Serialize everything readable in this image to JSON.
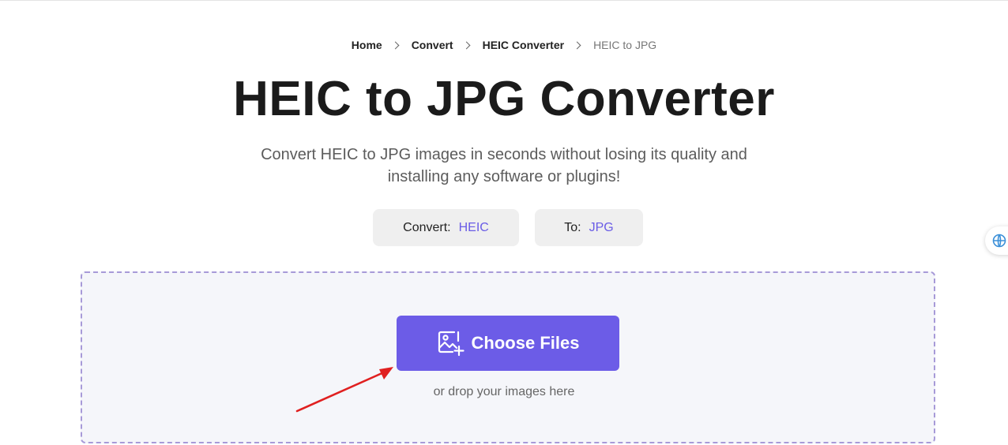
{
  "breadcrumb": {
    "items": [
      "Home",
      "Convert",
      "HEIC Converter",
      "HEIC to JPG"
    ]
  },
  "page": {
    "title": "HEIC to JPG Converter",
    "subtitle": "Convert HEIC to JPG images in seconds without losing its quality and installing any software or plugins!"
  },
  "format_selector": {
    "convert_label": "Convert:",
    "convert_value": "HEIC",
    "to_label": "To:",
    "to_value": "JPG"
  },
  "upload": {
    "button_label": "Choose Files",
    "drop_hint": "or drop your images here"
  },
  "colors": {
    "accent": "#6c5ce7",
    "annotation_arrow": "#e02020"
  },
  "icons": {
    "upload_button": "image-add-icon",
    "side_widget": "ai-assistant-icon"
  }
}
